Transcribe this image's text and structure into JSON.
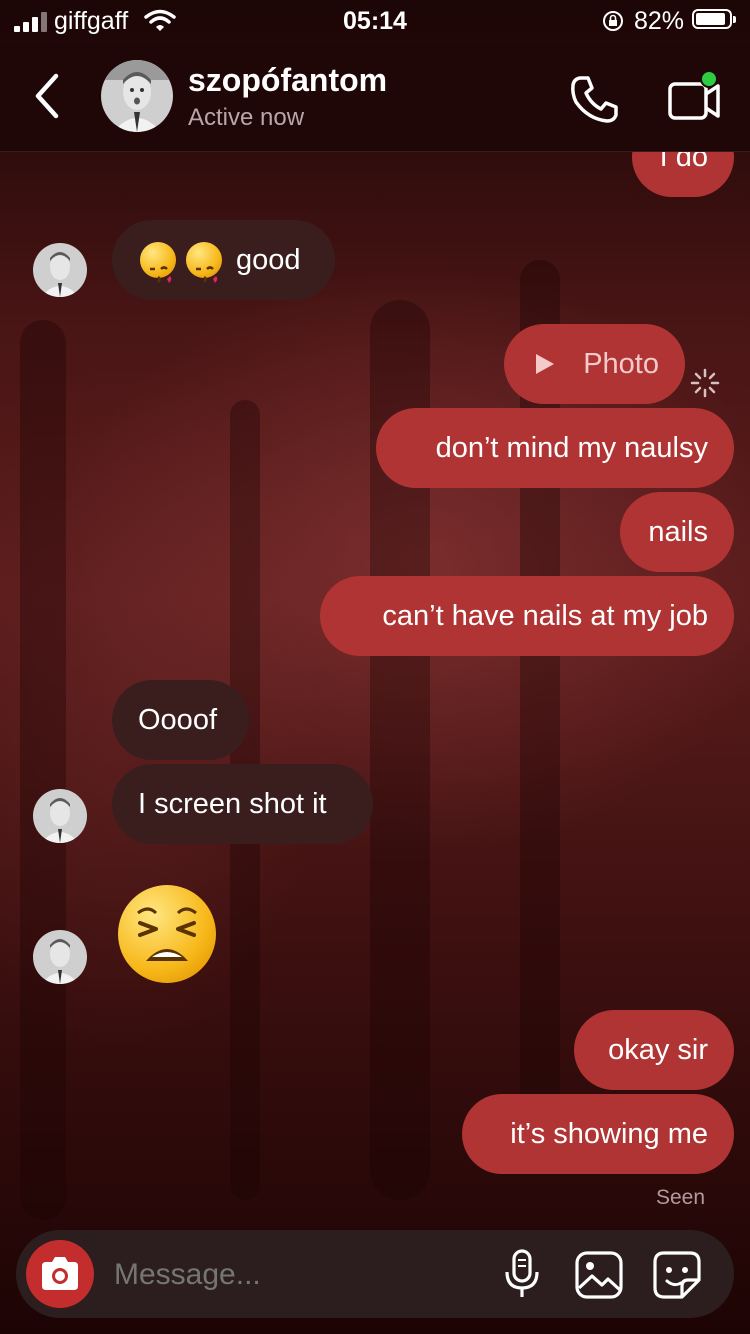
{
  "status_bar": {
    "carrier": "giffgaff",
    "time": "05:14",
    "battery_percent": "82%",
    "battery_level": 0.82
  },
  "header": {
    "username": "szopófantom",
    "status": "Active now",
    "back_icon": "chevron-left-icon",
    "call_icon": "phone-icon",
    "video_icon": "video-camera-icon",
    "online_dot_color": "#2ecc40"
  },
  "messages": [
    {
      "from": "me",
      "text": "I do"
    },
    {
      "from": "them",
      "text": "good",
      "emoji_prefix": "kissing-face-heart x2"
    },
    {
      "from": "me",
      "text": "Photo",
      "type": "photo"
    },
    {
      "from": "me",
      "text": "don’t mind my naulsy"
    },
    {
      "from": "me",
      "text": "nails"
    },
    {
      "from": "me",
      "text": "can’t have nails at my job"
    },
    {
      "from": "them",
      "text": "Oooof"
    },
    {
      "from": "them",
      "text": "I screen shot it"
    },
    {
      "from": "them",
      "text": "",
      "type": "emoji",
      "emoji": "weary-face"
    },
    {
      "from": "me",
      "text": "okay sir"
    },
    {
      "from": "me",
      "text": "it’s showing me"
    }
  ],
  "seen_label": "Seen",
  "composer": {
    "placeholder": "Message...",
    "camera_icon": "camera-icon",
    "mic_icon": "microphone-icon",
    "gallery_icon": "image-icon",
    "sticker_icon": "sticker-icon"
  },
  "colors": {
    "sent_bubble": "#b03434",
    "received_bubble": "#3a1e1e",
    "camera_button": "#c42d2d"
  }
}
